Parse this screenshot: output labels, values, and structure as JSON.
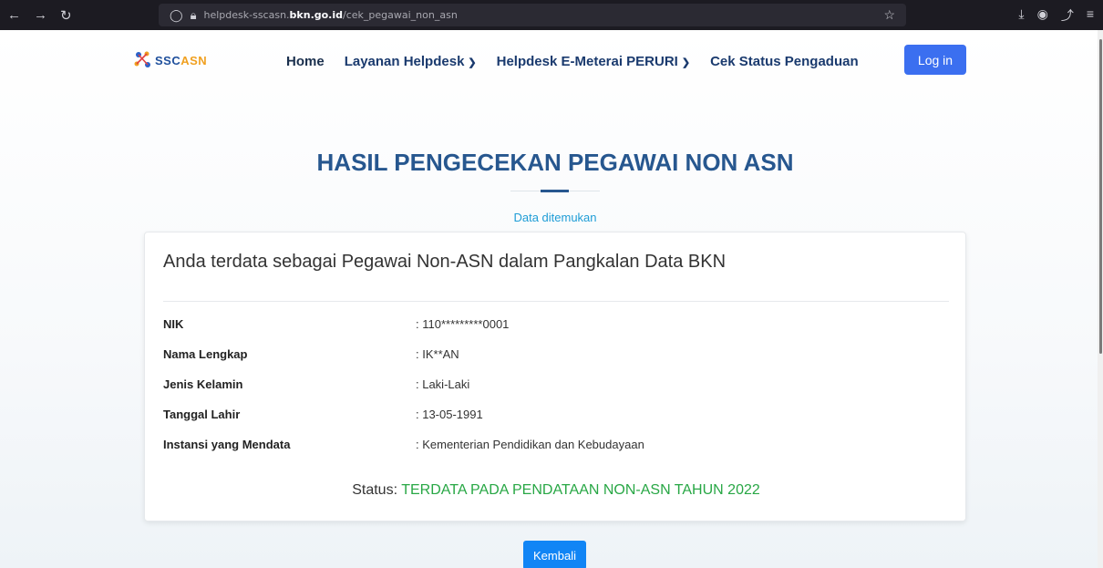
{
  "browser": {
    "url_prefix": "helpdesk-sscasn.",
    "url_domain": "bkn.go.id",
    "url_path": "/cek_pegawai_non_asn"
  },
  "header": {
    "logo_text_main": "SSC",
    "logo_text_accent": "ASN",
    "menu": [
      {
        "label": "Home"
      },
      {
        "label": "Layanan Helpdesk"
      },
      {
        "label": "Helpdesk E-Meterai PERURI"
      },
      {
        "label": "Cek Status Pengaduan"
      }
    ],
    "login_label": "Log in"
  },
  "main": {
    "title": "HASIL PENGECEKAN PEGAWAI NON ASN",
    "found_text": "Data ditemukan",
    "card_title": "Anda terdata sebagai Pegawai Non-ASN dalam Pangkalan Data BKN",
    "rows": [
      {
        "label": "NIK",
        "value": ": 110*********0001"
      },
      {
        "label": "Nama Lengkap",
        "value": ": IK**AN"
      },
      {
        "label": "Jenis Kelamin",
        "value": ": Laki-Laki"
      },
      {
        "label": "Tanggal Lahir",
        "value": ": 13-05-1991"
      },
      {
        "label": "Instansi yang Mendata",
        "value": ": Kementerian Pendidikan dan Kebudayaan"
      }
    ],
    "status_label": "Status: ",
    "status_value": "TERDATA PADA PENDATAAN NON-ASN TAHUN 2022",
    "back_label": "Kembali"
  },
  "colors": {
    "primary_blue": "#27578f",
    "button_blue": "#1185f5",
    "status_green": "#28a745"
  }
}
